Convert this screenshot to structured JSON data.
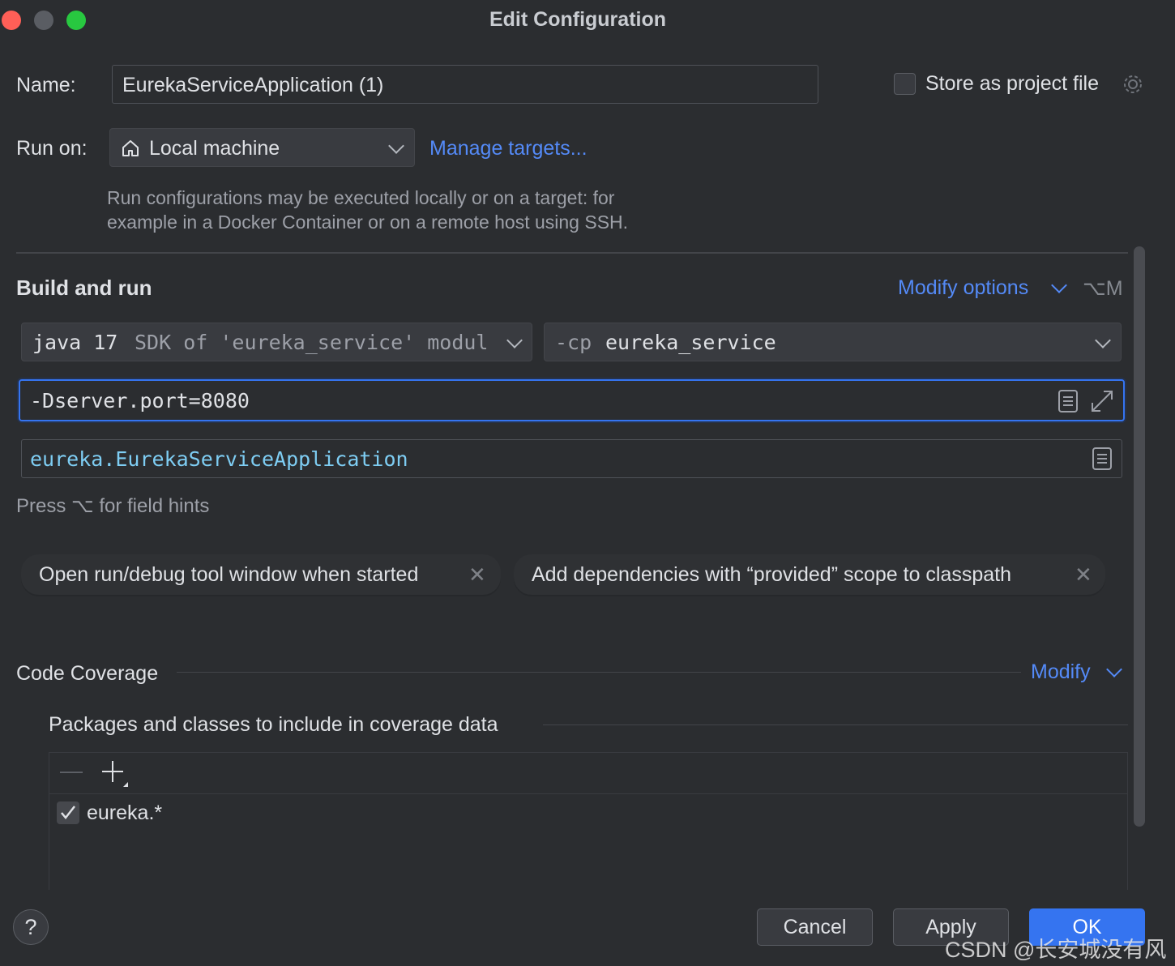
{
  "window": {
    "title": "Edit Configuration"
  },
  "traffic_lights": {
    "close": "#ff5f57",
    "minimize": "#5a5d63",
    "zoom": "#28c840"
  },
  "name_row": {
    "label": "Name:",
    "value": "EurekaServiceApplication (1)"
  },
  "store_project_file": {
    "label": "Store as project file",
    "checked": false,
    "icon": "gear-icon"
  },
  "run_on": {
    "label": "Run on:",
    "selected": "Local machine",
    "icon": "house-icon",
    "manage_link": "Manage targets...",
    "hint_line1": "Run configurations may be executed locally or on a target: for",
    "hint_line2": "example in a Docker Container or on a remote host using SSH."
  },
  "build_and_run": {
    "heading": "Build and run",
    "modify_options": "Modify options",
    "shortcut": "⌥M",
    "jdk": {
      "version": "java 17",
      "detail": "SDK of 'eureka_service' modul"
    },
    "classpath": {
      "flag": "-cp",
      "module": "eureka_service"
    },
    "vm_options": "-Dserver.port=8080",
    "main_class": "eureka.EurekaServiceApplication",
    "field_hint": "Press ⌥ for field hints"
  },
  "option_tags": [
    {
      "label": "Open run/debug tool window when started"
    },
    {
      "label": "Add dependencies with “provided” scope to classpath"
    }
  ],
  "code_coverage": {
    "heading": "Code Coverage",
    "modify": "Modify",
    "packages_heading": "Packages and classes to include in coverage data",
    "toolbar": {
      "remove": "—",
      "add": "+"
    },
    "items": [
      {
        "pattern": "eureka.*",
        "checked": true
      }
    ]
  },
  "footer": {
    "help": "?",
    "cancel": "Cancel",
    "apply": "Apply",
    "ok": "OK",
    "watermark": "CSDN @长安城没有风"
  },
  "colors": {
    "accent": "#3574f0",
    "link": "#548af7",
    "background": "#2b2d30",
    "focus": "#3574f0"
  }
}
